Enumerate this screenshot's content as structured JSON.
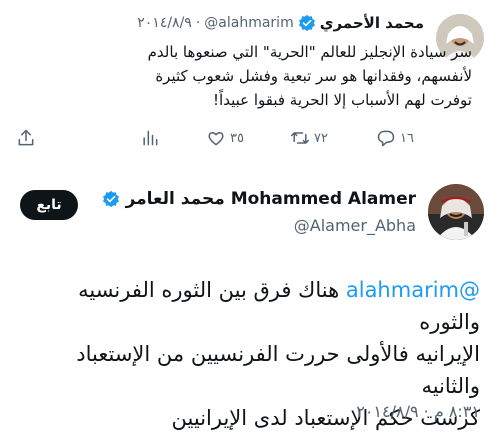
{
  "parent_tweet": {
    "author_name": "محمد الأحمري",
    "handle": "@alahmarim",
    "separator": "·",
    "date": "٢٠١٤/٨/٩",
    "text_lines": [
      "سر سيادة الإنجليز للعالم \"الحرية\" التي صنعوها بالدم",
      "لأنفسهم، وفقدانها هو سر تبعية وفشل شعوب كثيرة",
      "توفرت لهم الأسباب إلا الحرية فبقوا عبيداً!"
    ],
    "actions": {
      "replies": "١٦",
      "retweets": "٧٢",
      "likes": "٣٥"
    }
  },
  "main_tweet": {
    "author_name": "محمد العامر Mohammed Alamer",
    "handle": "@Alamer_Abha",
    "follow_label": "تابع",
    "mention": "@alahmarim",
    "text_line1_rest": " هناك فرق بين الثوره الفرنسيه والثوره",
    "text_lines_rest": [
      "الإيرانيه فالأولى حررت الفرنسيين من الإستعباد والثانيه",
      "كرست حكم الإستعباد لدى الإيرانيين"
    ],
    "timestamp": "٨:٣١ م · ٢٠١٤/٨/٩"
  },
  "colors": {
    "accent": "#1d9bf0",
    "text": "#0f1419",
    "secondary": "#536471",
    "follow_bg": "#0f1419"
  },
  "icons": [
    "verified-badge-icon",
    "reply-icon",
    "retweet-icon",
    "like-icon",
    "analytics-icon",
    "share-icon"
  ]
}
